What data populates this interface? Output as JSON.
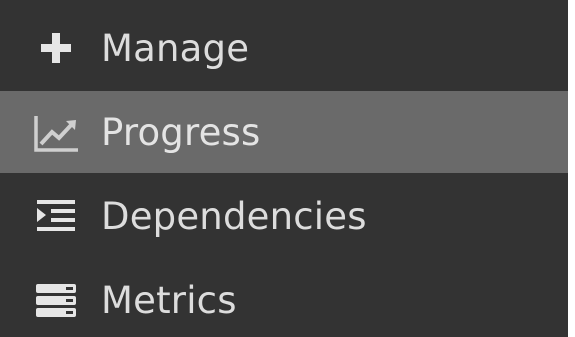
{
  "menu": {
    "items": [
      {
        "label": "Manage",
        "icon": "plus-icon",
        "active": false
      },
      {
        "label": "Progress",
        "icon": "line-chart-icon",
        "active": true
      },
      {
        "label": "Dependencies",
        "icon": "indent-icon",
        "active": false
      },
      {
        "label": "Metrics",
        "icon": "server-stack-icon",
        "active": false
      }
    ]
  },
  "colors": {
    "background": "#333333",
    "active_background": "#6a6a6a",
    "text": "#dddddd"
  }
}
